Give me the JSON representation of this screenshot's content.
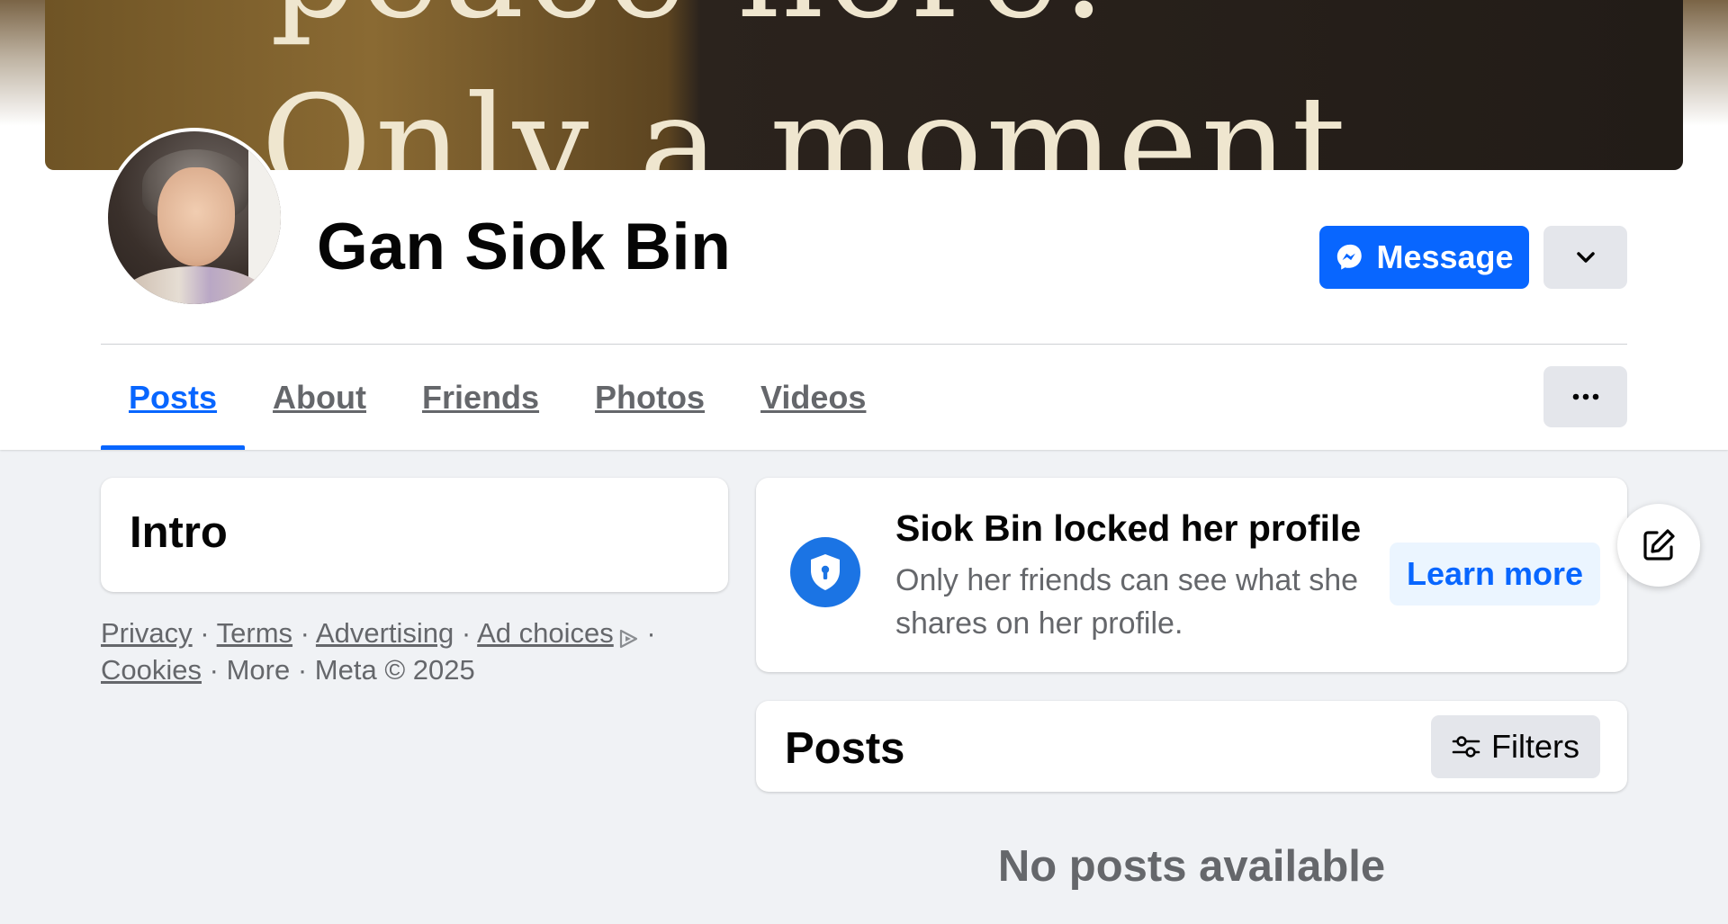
{
  "cover": {
    "line1": "peace here.",
    "line2": "Only a moment"
  },
  "profile": {
    "name": "Gan Siok Bin"
  },
  "actions": {
    "message_label": "Message"
  },
  "tabs": [
    {
      "label": "Posts",
      "active": true
    },
    {
      "label": "About",
      "active": false
    },
    {
      "label": "Friends",
      "active": false
    },
    {
      "label": "Photos",
      "active": false
    },
    {
      "label": "Videos",
      "active": false
    }
  ],
  "intro": {
    "title": "Intro"
  },
  "footer": {
    "privacy": "Privacy",
    "terms": "Terms",
    "advertising": "Advertising",
    "ad_choices": "Ad choices",
    "cookies": "Cookies",
    "more": "More",
    "copyright": "Meta © 2025",
    "sep": "·"
  },
  "locked_notice": {
    "title": "Siok Bin locked her profile",
    "description": "Only her friends can see what she shares on her profile.",
    "learn_more_label": "Learn more"
  },
  "posts": {
    "title": "Posts",
    "filters_label": "Filters",
    "empty_message": "No posts available"
  },
  "colors": {
    "accent": "#0866ff",
    "shield": "#1b74e4",
    "secondary_text": "#65676b",
    "background": "#f0f2f5"
  },
  "icons": {
    "messenger": "messenger-icon",
    "chevron": "chevron-down-icon",
    "more": "more-dots-icon",
    "shield": "shield-lock-icon",
    "filters": "sliders-icon",
    "edit": "compose-edit-icon",
    "adchoices": "adchoices-icon"
  }
}
